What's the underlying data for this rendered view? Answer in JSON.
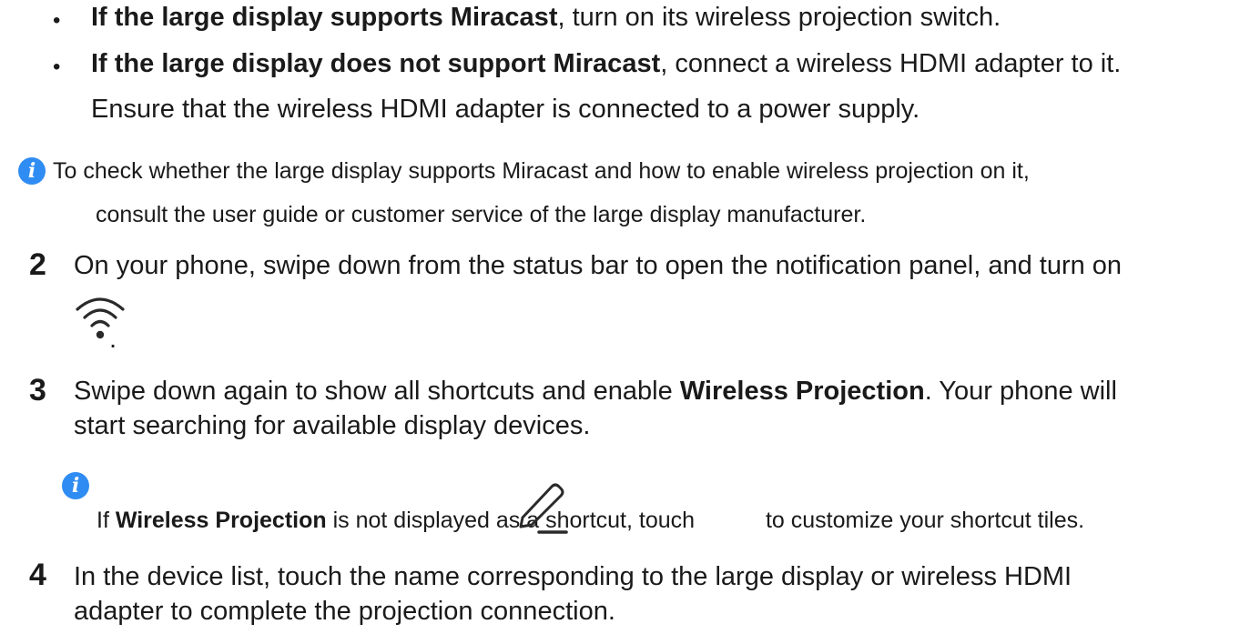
{
  "bullets": [
    {
      "marker": "•",
      "bold": "If the large display supports Miracast",
      "text": ", turn on its wireless projection switch."
    },
    {
      "marker": "•",
      "bold": "If the large display does not support Miracast",
      "text": ", connect a wireless HDMI adapter to it.",
      "line2": "Ensure that the wireless HDMI adapter is connected to a power supply."
    }
  ],
  "note1": {
    "icon": "info-icon",
    "line1": "To check whether the large display supports Miracast and how to enable wireless projection on it,",
    "line2": "consult the user guide or customer service of the large display manufacturer."
  },
  "steps": [
    {
      "number": "2",
      "line1": "On your phone, swipe down from the status bar to open the notification panel, and turn on",
      "icon": "wifi-icon",
      "after_icon": "."
    },
    {
      "number": "3",
      "pre": "Swipe down again to show all shortcuts and enable ",
      "bold": "Wireless Projection",
      "post": ". Your phone will",
      "line2": "start searching for available display devices."
    },
    {
      "number": "4",
      "line1": "In the device list, touch the name corresponding to the large display or wireless HDMI",
      "line2": "adapter to complete the projection connection."
    }
  ],
  "note2": {
    "icon": "info-icon",
    "pre": "If ",
    "bold": "Wireless Projection",
    "mid": " is not displayed as a shortcut, touch ",
    "edit_icon": "edit-pencil-icon",
    "post": " to customize your shortcut tiles."
  },
  "colors": {
    "info_icon": "#2f8cf2",
    "text": "#1a1a1a"
  }
}
